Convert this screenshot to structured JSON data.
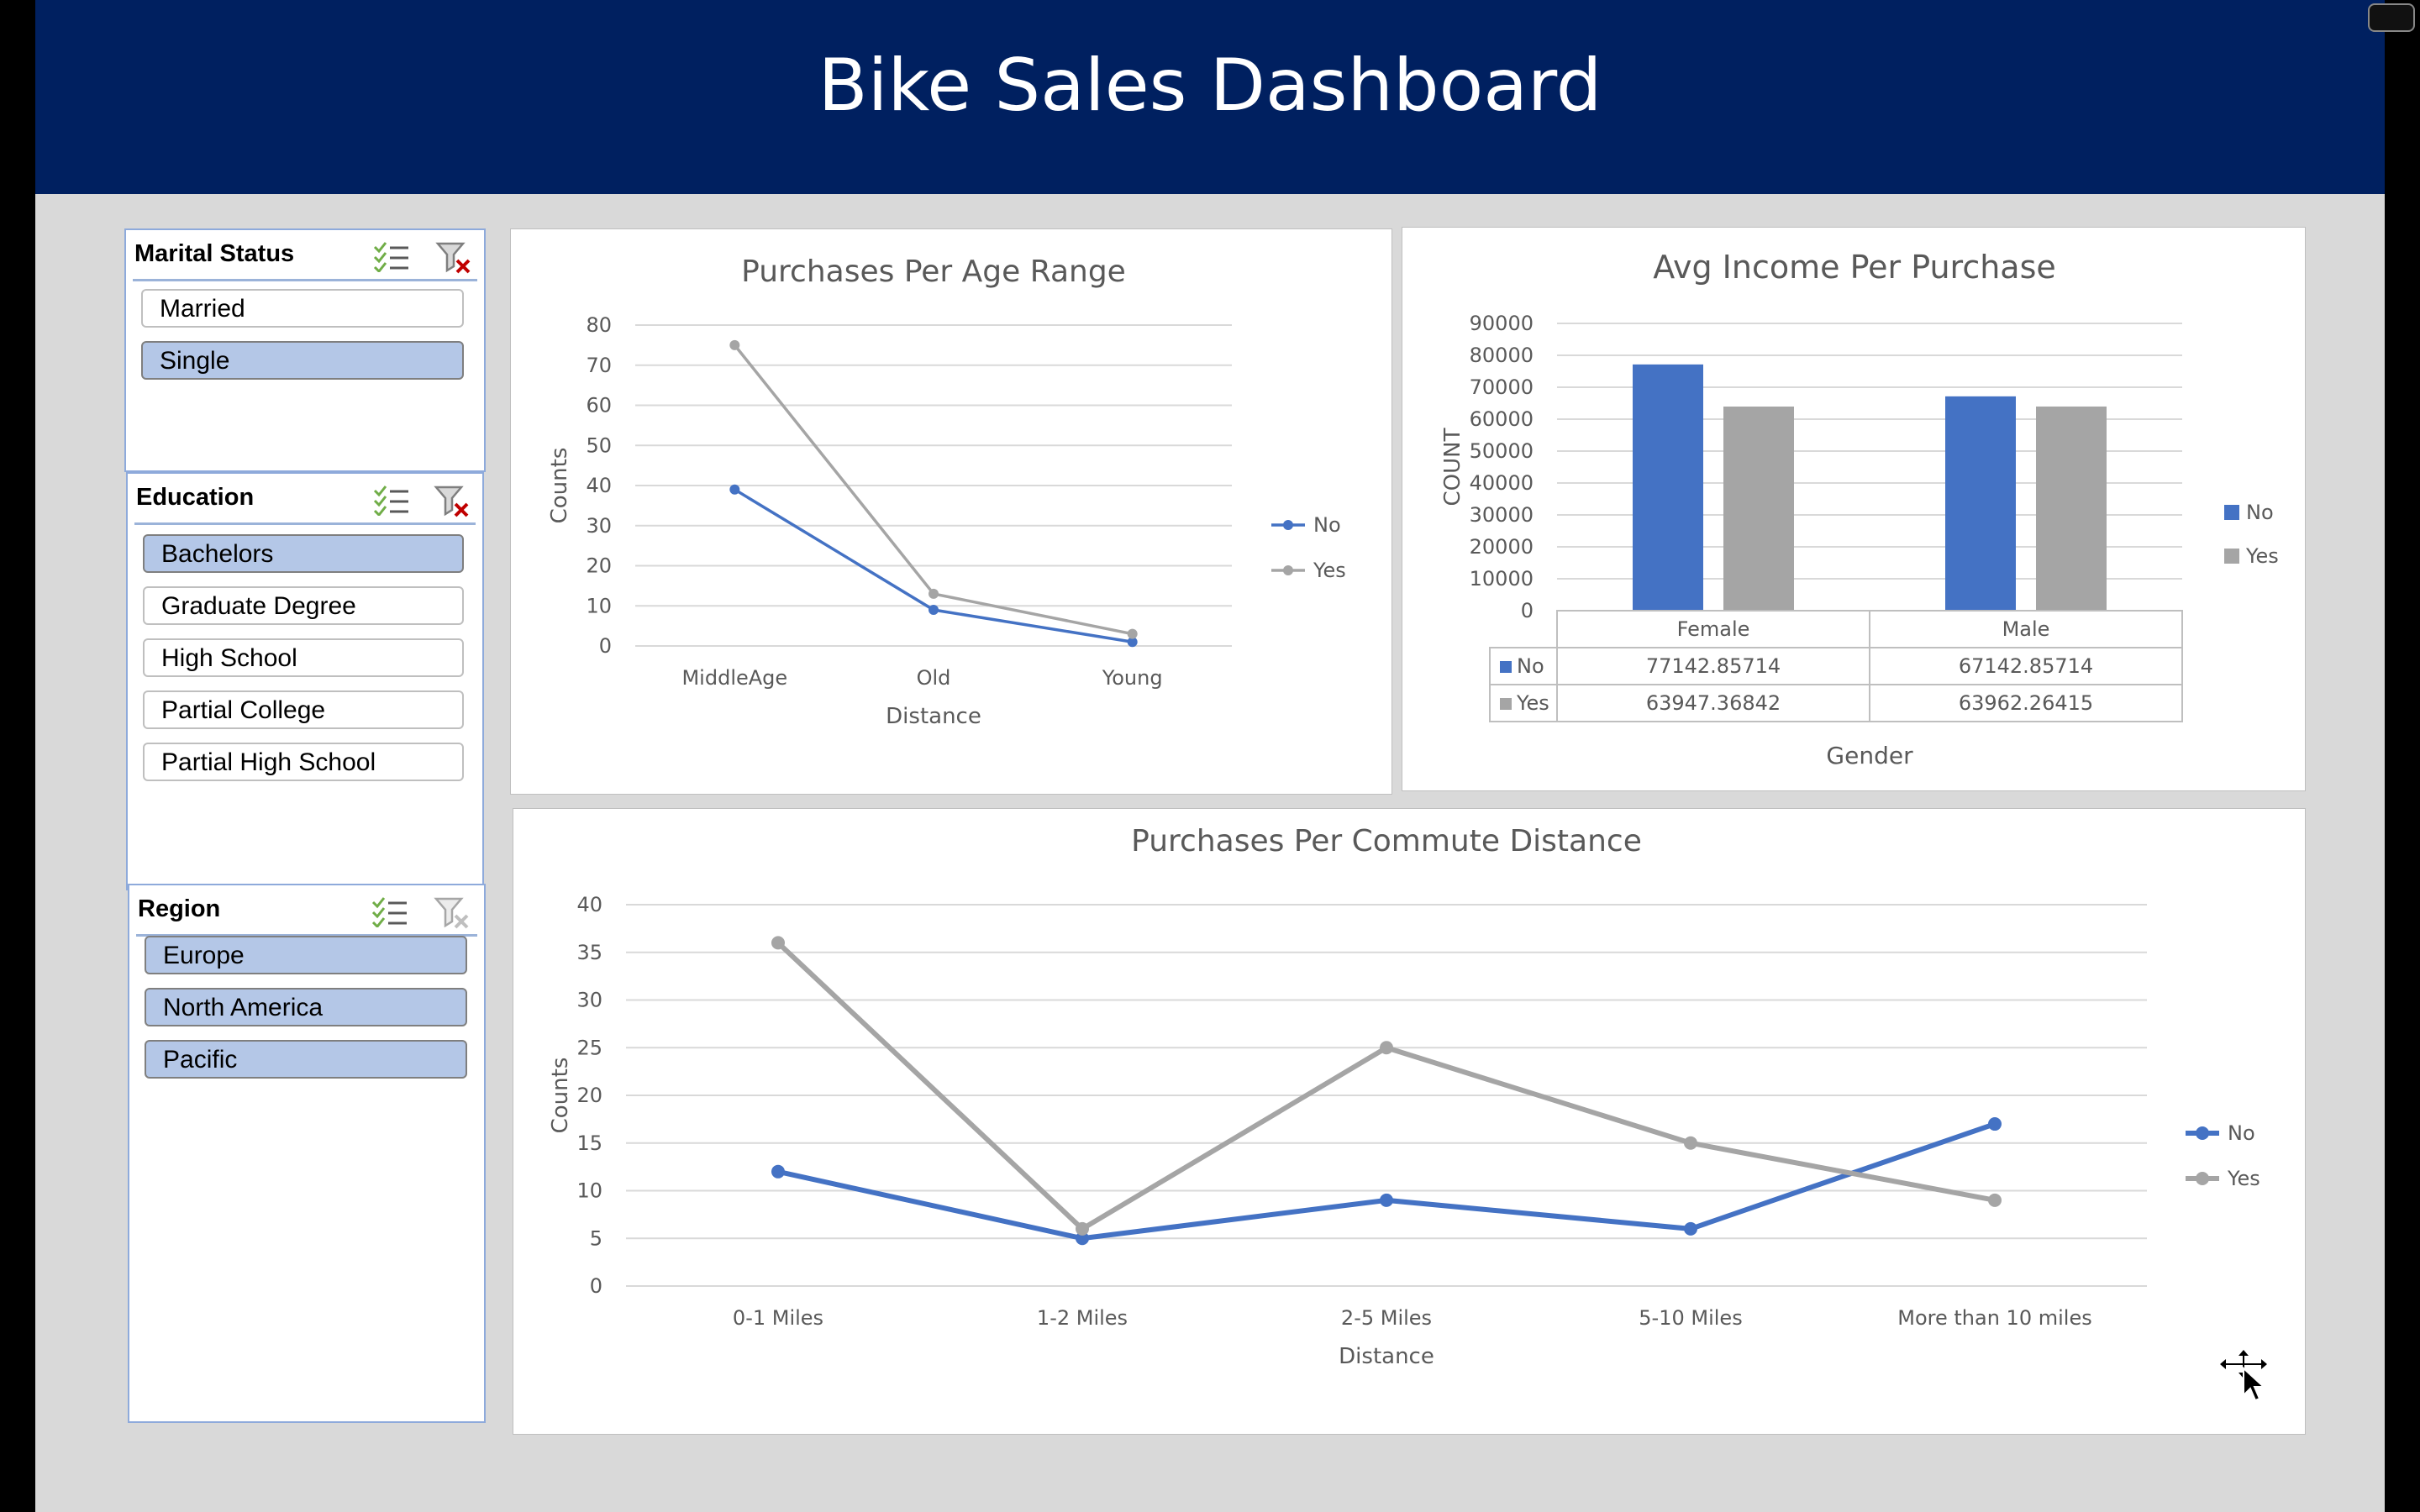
{
  "dashboard": {
    "title": "Bike Sales Dashboard"
  },
  "slicers": {
    "marital": {
      "title": "Marital Status",
      "items": [
        {
          "label": "Married",
          "selected": false
        },
        {
          "label": "Single",
          "selected": true
        }
      ]
    },
    "education": {
      "title": "Education",
      "items": [
        {
          "label": "Bachelors",
          "selected": true
        },
        {
          "label": "Graduate Degree",
          "selected": false
        },
        {
          "label": "High School",
          "selected": false
        },
        {
          "label": "Partial College",
          "selected": false
        },
        {
          "label": "Partial High School",
          "selected": false
        }
      ]
    },
    "region": {
      "title": "Region",
      "items": [
        {
          "label": "Europe",
          "selected": true
        },
        {
          "label": "North America",
          "selected": true
        },
        {
          "label": "Pacific",
          "selected": true
        }
      ]
    }
  },
  "icons": {
    "multiselect": "multi-select-icon",
    "clear_filter": "clear-filter-icon",
    "cursor": "move-cursor-icon"
  },
  "colors": {
    "banner": "#002060",
    "no": "#4472C4",
    "yes": "#A5A5A5",
    "selected_item": "#B4C7E7"
  },
  "chart_data": [
    {
      "id": "age",
      "type": "line",
      "title": "Purchases Per Age Range",
      "xlabel": "Distance",
      "ylabel": "Counts",
      "categories": [
        "MiddleAge",
        "Old",
        "Young"
      ],
      "ylim": [
        0,
        80
      ],
      "yticks": [
        0,
        10,
        20,
        30,
        40,
        50,
        60,
        70,
        80
      ],
      "series": [
        {
          "name": "No",
          "values": [
            39,
            9,
            1
          ]
        },
        {
          "name": "Yes",
          "values": [
            75,
            13,
            3
          ]
        }
      ],
      "legend": "right",
      "grid": true
    },
    {
      "id": "income",
      "type": "bar",
      "title": "Avg Income Per Purchase",
      "xlabel": "Gender",
      "ylabel": "COUNT",
      "categories": [
        "Female",
        "Male"
      ],
      "ylim": [
        0,
        90000
      ],
      "yticks": [
        0,
        10000,
        20000,
        30000,
        40000,
        50000,
        60000,
        70000,
        80000,
        90000
      ],
      "series": [
        {
          "name": "No",
          "values": [
            77142.85714,
            67142.85714
          ],
          "labels": [
            "77142.85714",
            "67142.85714"
          ]
        },
        {
          "name": "Yes",
          "values": [
            63947.36842,
            63962.26415
          ],
          "labels": [
            "63947.36842",
            "63962.26415"
          ]
        }
      ],
      "data_table": true,
      "legend": "right",
      "grid": true
    },
    {
      "id": "commute",
      "type": "line",
      "title": "Purchases Per Commute Distance",
      "xlabel": "Distance",
      "ylabel": "Counts",
      "categories": [
        "0-1 Miles",
        "1-2 Miles",
        "2-5 Miles",
        "5-10 Miles",
        "More than 10 miles"
      ],
      "ylim": [
        0,
        40
      ],
      "yticks": [
        0,
        5,
        10,
        15,
        20,
        25,
        30,
        35,
        40
      ],
      "series": [
        {
          "name": "No",
          "values": [
            12,
            5,
            9,
            6,
            17
          ]
        },
        {
          "name": "Yes",
          "values": [
            36,
            6,
            25,
            15,
            9
          ]
        }
      ],
      "legend": "right",
      "grid": true
    }
  ]
}
